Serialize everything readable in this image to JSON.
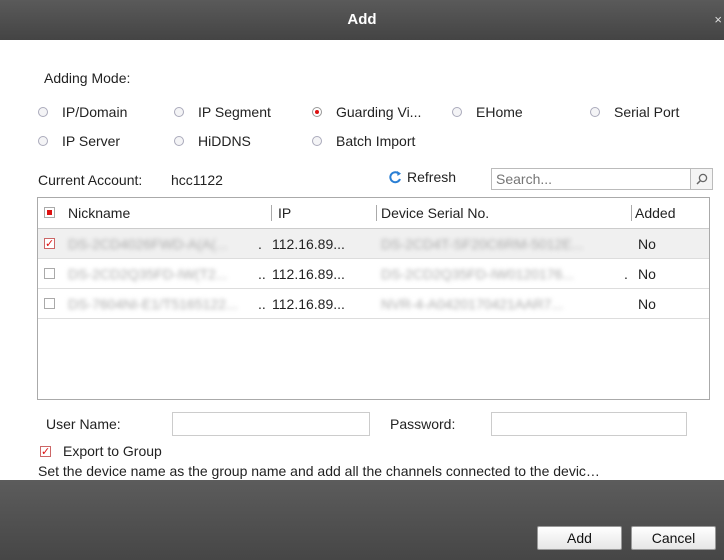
{
  "window": {
    "title": "Add",
    "close_glyph": "×"
  },
  "adding_mode": {
    "label": "Adding Mode:",
    "options": [
      {
        "label": "IP/Domain",
        "selected": false
      },
      {
        "label": "IP Segment",
        "selected": false
      },
      {
        "label": "Guarding Vi...",
        "selected": true
      },
      {
        "label": "EHome",
        "selected": false
      },
      {
        "label": "Serial Port",
        "selected": false
      },
      {
        "label": "IP Server",
        "selected": false
      },
      {
        "label": "HiDDNS",
        "selected": false
      },
      {
        "label": "Batch Import",
        "selected": false
      }
    ]
  },
  "account": {
    "label": "Current Account:",
    "value": "hcc1122"
  },
  "refresh": {
    "label": "Refresh",
    "icon": "refresh-icon"
  },
  "search": {
    "placeholder": "Search...",
    "icon": "search-icon"
  },
  "table": {
    "columns": [
      "Nickname",
      "IP",
      "Device Serial No.",
      "Added"
    ],
    "rows": [
      {
        "nickname": "DS-2CD4026FWD-A(A(...",
        "nickname_suffix": ".",
        "ip": "112.16.89...",
        "serial": "DS-2CD4T-SF20C6RM-5012E...",
        "added": "No",
        "checked": true
      },
      {
        "nickname": "DS-2CD2Q35FD-IW(T2...",
        "nickname_suffix": "..",
        "ip": "112.16.89...",
        "serial": "DS-2CD2Q35FD-IW0120176...",
        "serial_suffix": ".",
        "added": "No",
        "checked": false
      },
      {
        "nickname": "DS-7604NI-E1/T5165122...",
        "nickname_suffix": "..",
        "ip": "112.16.89...",
        "serial": "NVR-4-A0420170421AAR7...",
        "added": "No",
        "checked": false
      }
    ]
  },
  "credentials": {
    "username_label": "User Name:",
    "password_label": "Password:"
  },
  "export_group": {
    "label": "Export to Group",
    "checked": true
  },
  "note": "Set the device name as the group name and add all the channels connected to the devic…",
  "buttons": {
    "add": "Add",
    "cancel": "Cancel"
  },
  "colors": {
    "accent": "#dd1111",
    "titlebar": "#4a4a4a",
    "refresh_icon": "#2a7fd4"
  }
}
